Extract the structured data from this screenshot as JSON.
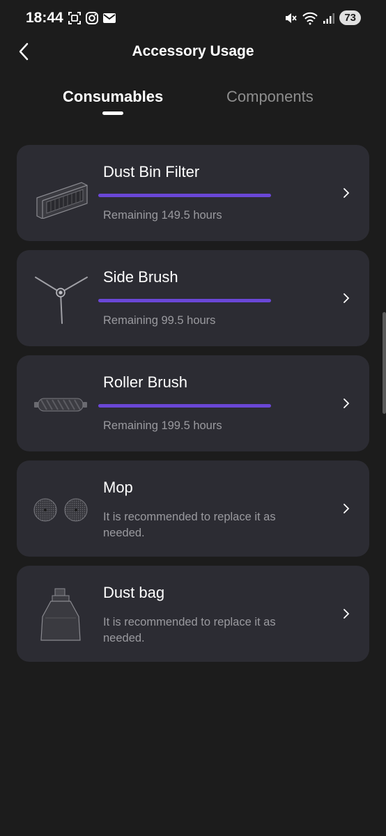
{
  "status_bar": {
    "time": "18:44",
    "battery": "73",
    "left_icons": [
      "screenshot-icon",
      "instagram-icon",
      "mail-icon"
    ],
    "right_icons": [
      "mute-icon",
      "wifi-icon",
      "signal-icon"
    ]
  },
  "header": {
    "title": "Accessory Usage",
    "back_icon": "back-arrow-icon"
  },
  "tabs": [
    {
      "label": "Consumables",
      "active": true
    },
    {
      "label": "Components",
      "active": false
    }
  ],
  "accessories": [
    {
      "name": "Dust Bin Filter",
      "icon": "dust-bin-filter-icon",
      "remaining": "Remaining 149.5 hours",
      "progress": 1.0
    },
    {
      "name": "Side Brush",
      "icon": "side-brush-icon",
      "remaining": "Remaining 99.5 hours",
      "progress": 1.0
    },
    {
      "name": "Roller Brush",
      "icon": "roller-brush-icon",
      "remaining": "Remaining 199.5 hours",
      "progress": 1.0
    },
    {
      "name": "Mop",
      "icon": "mop-icon",
      "note": "It is recommended to replace it as needed."
    },
    {
      "name": "Dust bag",
      "icon": "dust-bag-icon",
      "note": "It is recommended to replace it as needed."
    }
  ],
  "colors": {
    "background": "#1c1c1c",
    "card": "#2c2c33",
    "accent": "#6a47d6",
    "secondary_text": "#9a9a9f",
    "inactive_tab": "#8e8e8e"
  }
}
